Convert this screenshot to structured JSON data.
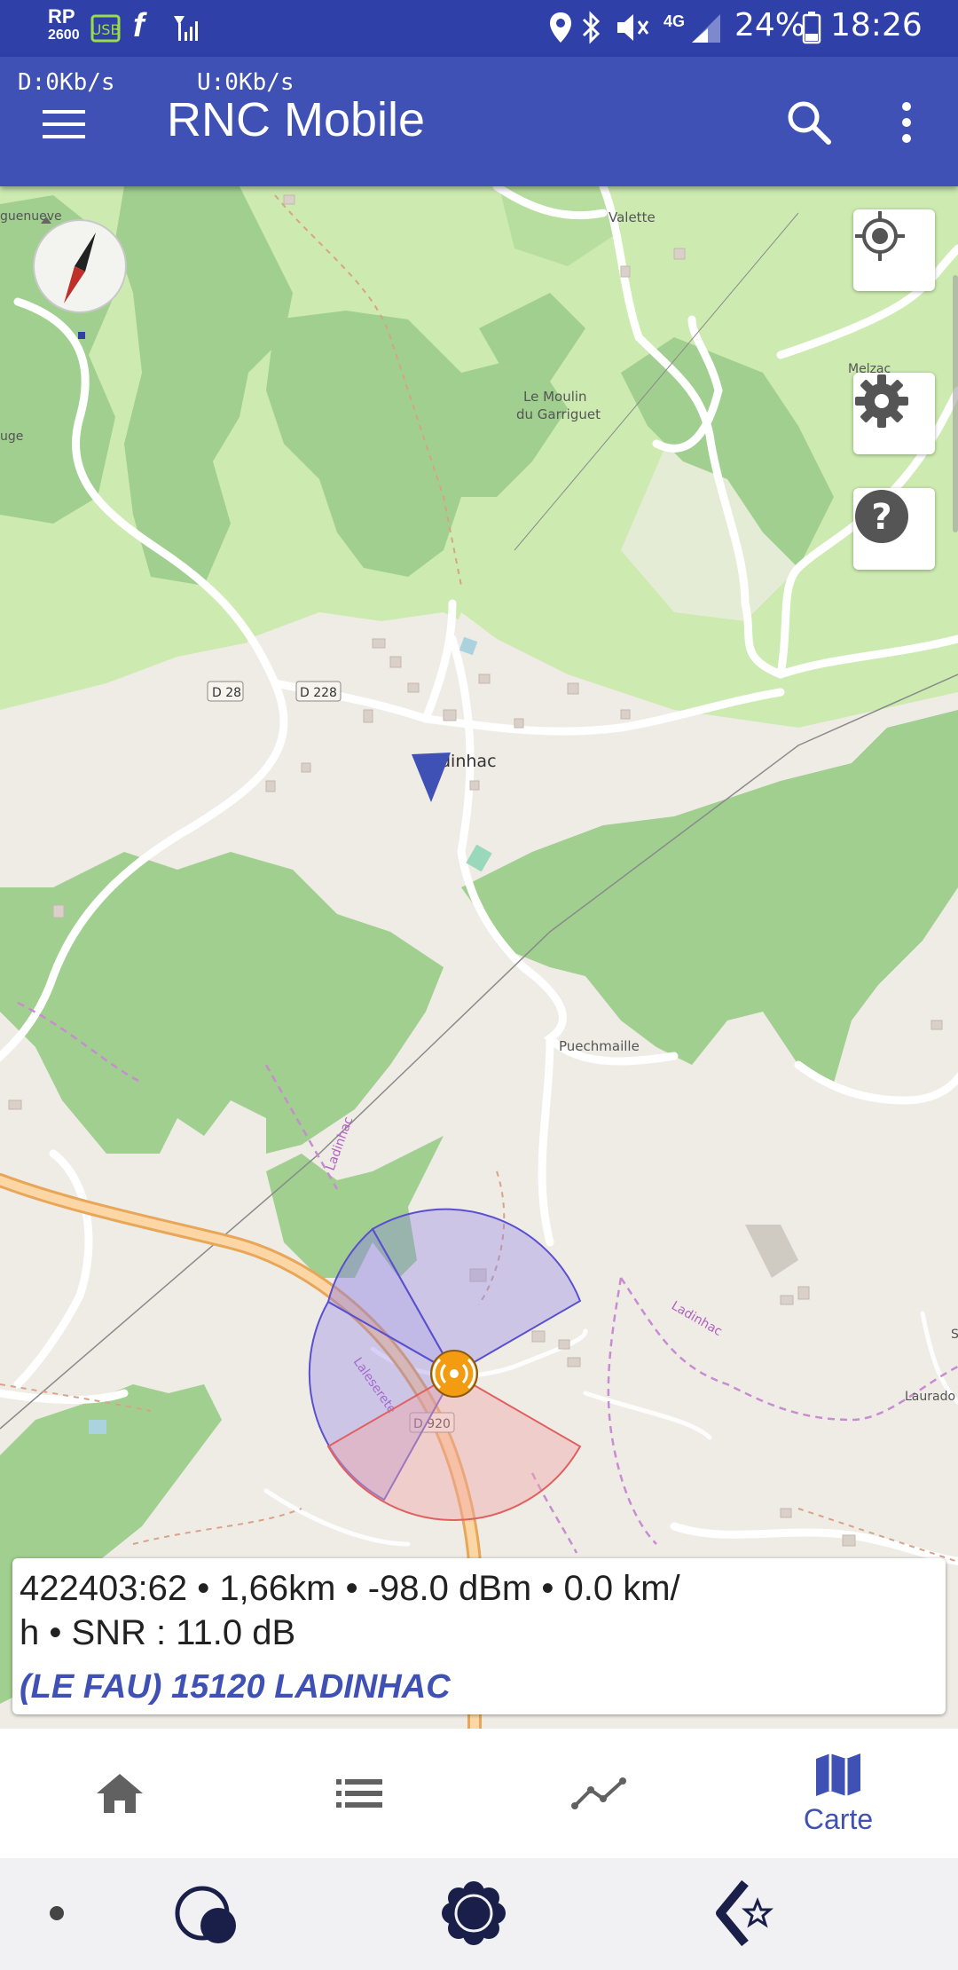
{
  "status_bar": {
    "rp_top": "RP",
    "rp_bottom": "2600",
    "battery_percent": "24%",
    "network": "4G",
    "time": "18:26",
    "icons": [
      "rp-icon",
      "usb-icon",
      "f-icon",
      "signal-small-icon",
      "location-icon",
      "bluetooth-icon",
      "mute-icon",
      "signal-icon",
      "battery-icon"
    ]
  },
  "app_bar": {
    "download_speed": "D:0Kb/s",
    "upload_speed": "U:0Kb/s",
    "title": "RNC Mobile"
  },
  "map": {
    "place_labels": {
      "aiguenueve": "guenueve",
      "valette": "Valette",
      "melzac": "Melzac",
      "uge": "uge",
      "moulin1": "Le Moulin",
      "moulin2": "du Garriguet",
      "d28": "D 28",
      "d228": "D 228",
      "ladinhac": "dinhac",
      "puechmaille": "Puechmaille",
      "ladinhac_path": "Ladinhac",
      "ladinhac_path2": "Ladinhac",
      "lauradou": "Laurado",
      "d920": "D 920",
      "lalleserete": "Laleserete",
      "s": "S"
    },
    "buttons": [
      "my-location-button",
      "settings-button",
      "help-button"
    ]
  },
  "info_card": {
    "line1": "422403:62 • 1,66km • -98.0 dBm • 0.0 km/",
    "line2": "h • SNR : 11.0 dB",
    "location": "(LE FAU) 15120 LADINHAC"
  },
  "bottom_nav": {
    "items": [
      {
        "icon": "home-icon",
        "label": ""
      },
      {
        "icon": "list-icon",
        "label": ""
      },
      {
        "icon": "chart-icon",
        "label": ""
      },
      {
        "icon": "map-icon",
        "label": "Carte"
      }
    ],
    "active_color": "#3f51b5",
    "inactive_color": "#616161"
  },
  "system_bar": {
    "icons": [
      "dot-icon",
      "moon-icon",
      "gear-flower-icon",
      "back-star-icon"
    ]
  },
  "colors": {
    "status_bar": "#2f41a8",
    "app_bar": "#3f51b5",
    "forest": "#a0cf8f",
    "meadow": "#cdebb0",
    "sector_blue": "#8c7fe6",
    "sector_red": "#f0a8a8"
  }
}
